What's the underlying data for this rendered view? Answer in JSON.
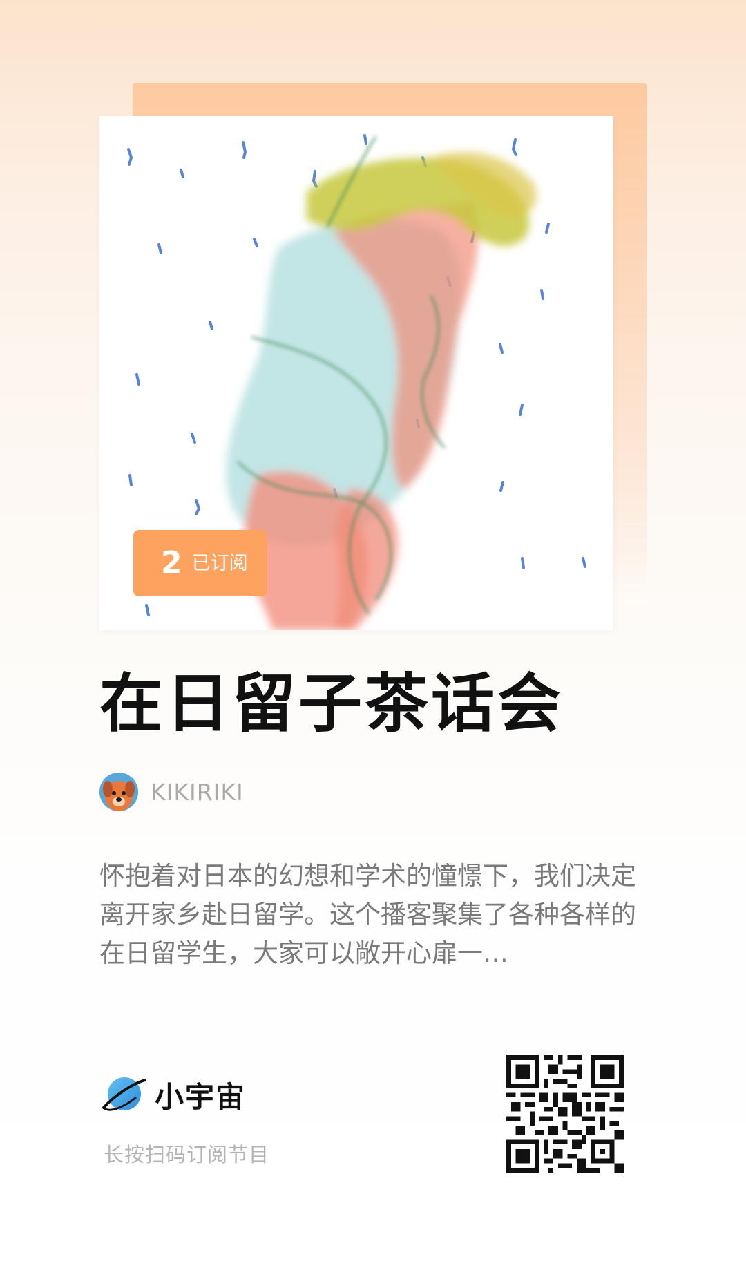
{
  "cover": {
    "subscribed_count": "2",
    "subscribed_label": "已订阅"
  },
  "podcast": {
    "title": "在日留子茶话会",
    "author": "KIKIRIKI",
    "description": "怀抱着对日本的幻想和学术的憧憬下，我们决定离开家乡赴日留学。这个播客聚集了各种各样的在日留学生，大家可以敞开心扉一…"
  },
  "footer": {
    "brand_name": "小宇宙",
    "brand_icon": "planet-icon",
    "hint": "长按扫码订阅节目"
  },
  "colors": {
    "accent": "#fda35f",
    "cover_back": "#fdc9a0",
    "title": "#111111",
    "muted": "#a9a9a9",
    "brand_blue": "#3fa5e6"
  }
}
